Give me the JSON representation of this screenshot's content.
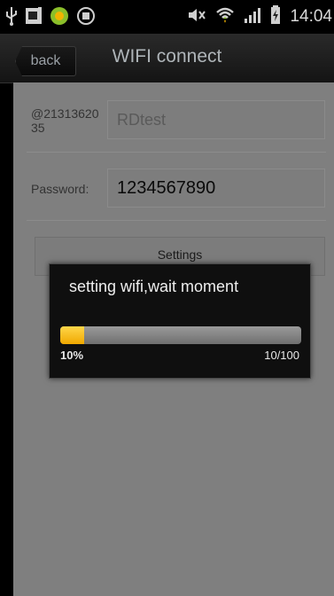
{
  "status_bar": {
    "time": "14:04",
    "icons": [
      "usb-icon",
      "gallery-icon",
      "app-icon",
      "stop-icon",
      "no-sound-icon",
      "wifi-icon",
      "signal-icon",
      "battery-icon"
    ]
  },
  "header": {
    "back_label": "back",
    "title": "WIFI connect"
  },
  "form": {
    "ssid_label": "@21313620\n35",
    "ssid_value": "RDtest",
    "password_label": "Password:",
    "password_value": "1234567890",
    "settings_label": "Settings"
  },
  "dialog": {
    "message": "setting wifi,wait moment",
    "progress_fraction": 0.1,
    "progress_percent_label": "10%",
    "progress_count_label": "10/100"
  },
  "colors": {
    "accent": "#f5b400",
    "background": "#7f7f7f",
    "titlebar": "#1b1b1b"
  }
}
